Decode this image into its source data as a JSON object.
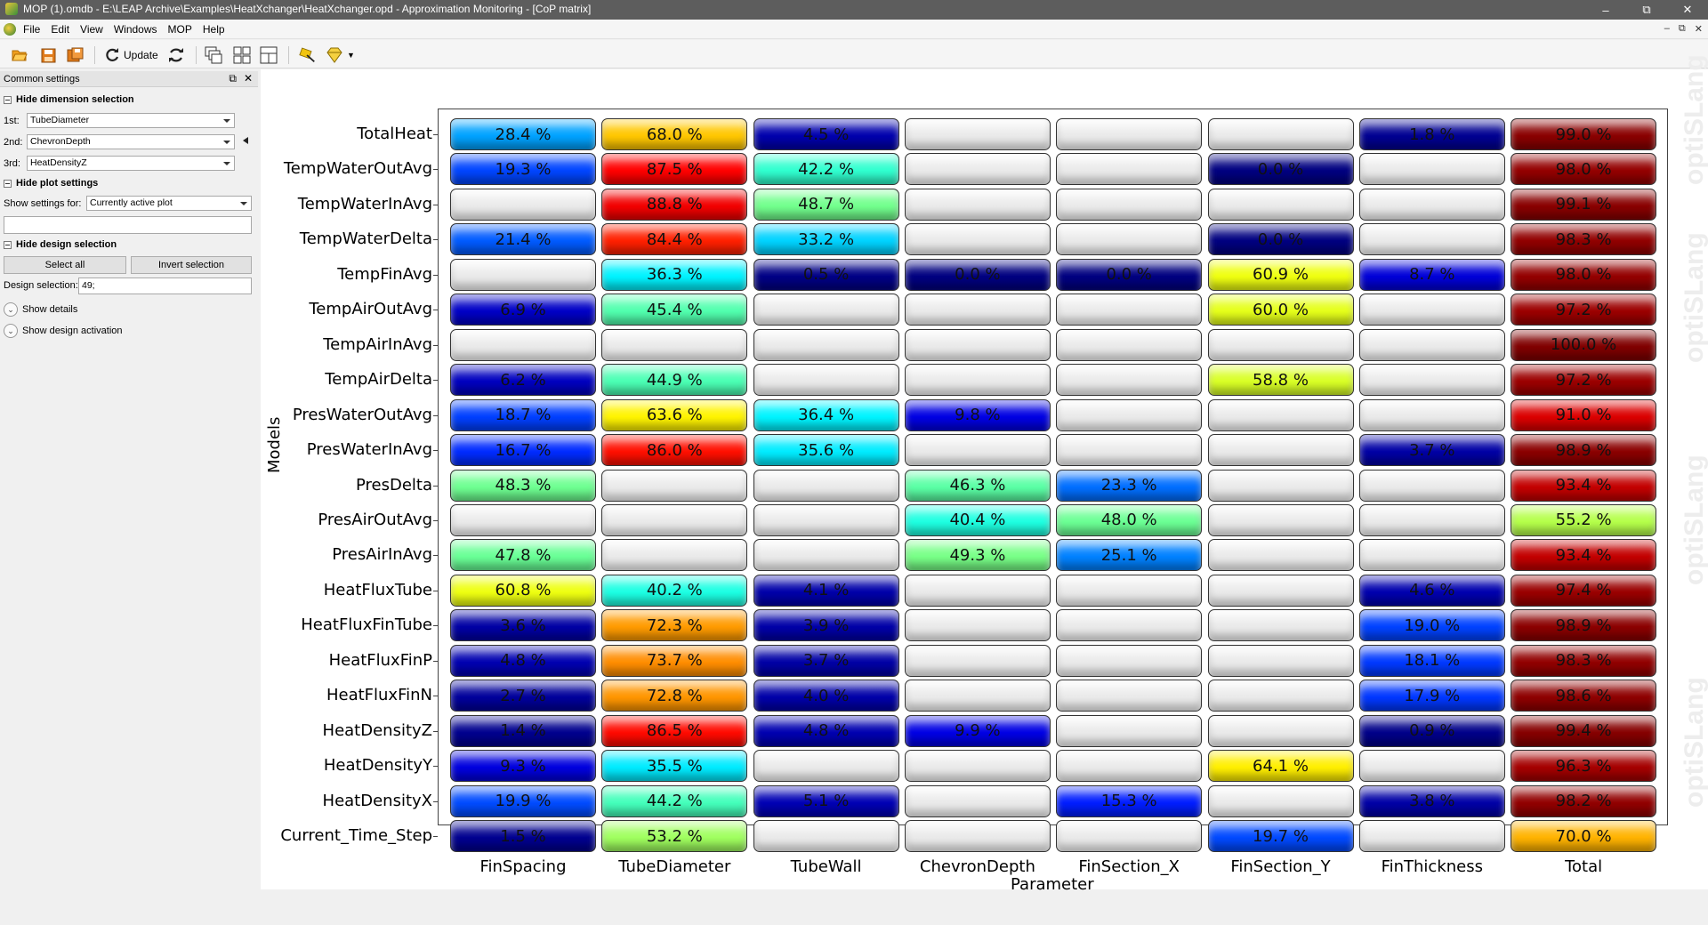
{
  "window": {
    "title": "MOP (1).omdb - E:\\LEAP Archive\\Examples\\HeatXchanger\\HeatXchanger.opd - Approximation Monitoring - [CoP matrix]"
  },
  "menu": [
    "File",
    "Edit",
    "View",
    "Windows",
    "MOP",
    "Help"
  ],
  "toolbar": {
    "update_label": "Update"
  },
  "left_panel": {
    "header": "Common settings",
    "dimension_section": "Hide dimension selection",
    "dim1_label": "1st:",
    "dim1_value": "TubeDiameter",
    "dim2_label": "2nd:",
    "dim2_value": "ChevronDepth",
    "dim3_label": "3rd:",
    "dim3_value": "HeatDensityZ",
    "plot_section": "Hide plot settings",
    "show_settings_label": "Show settings for:",
    "show_settings_value": "Currently active plot",
    "design_section": "Hide design selection",
    "select_all": "Select all",
    "invert_selection": "Invert selection",
    "design_selection_label": "Design selection:",
    "design_selection_value": "49;",
    "show_details": "Show details",
    "show_design_activation": "Show design activation"
  },
  "watermark": "optiSLang",
  "chart_data": {
    "type": "heatmap",
    "xlabel": "Parameter",
    "ylabel": "Models",
    "columns": [
      "FinSpacing",
      "TubeDiameter",
      "TubeWall",
      "ChevronDepth",
      "FinSection_X",
      "FinSection_Y",
      "FinThickness",
      "Total"
    ],
    "rows": [
      {
        "name": "TotalHeat",
        "values": [
          28.4,
          68.0,
          4.5,
          null,
          null,
          null,
          1.8,
          99.0
        ]
      },
      {
        "name": "TempWaterOutAvg",
        "values": [
          19.3,
          87.5,
          42.2,
          null,
          null,
          0.0,
          null,
          98.0
        ]
      },
      {
        "name": "TempWaterInAvg",
        "values": [
          null,
          88.8,
          48.7,
          null,
          null,
          null,
          null,
          99.1
        ]
      },
      {
        "name": "TempWaterDelta",
        "values": [
          21.4,
          84.4,
          33.2,
          null,
          null,
          0.0,
          null,
          98.3
        ]
      },
      {
        "name": "TempFinAvg",
        "values": [
          null,
          36.3,
          0.5,
          0.0,
          0.0,
          60.9,
          8.7,
          98.0
        ]
      },
      {
        "name": "TempAirOutAvg",
        "values": [
          6.9,
          45.4,
          null,
          null,
          null,
          60.0,
          null,
          97.2
        ]
      },
      {
        "name": "TempAirInAvg",
        "values": [
          null,
          null,
          null,
          null,
          null,
          null,
          null,
          100.0
        ]
      },
      {
        "name": "TempAirDelta",
        "values": [
          6.2,
          44.9,
          null,
          null,
          null,
          58.8,
          null,
          97.2
        ]
      },
      {
        "name": "PresWaterOutAvg",
        "values": [
          18.7,
          63.6,
          36.4,
          9.8,
          null,
          null,
          null,
          91.0
        ]
      },
      {
        "name": "PresWaterInAvg",
        "values": [
          16.7,
          86.0,
          35.6,
          null,
          null,
          null,
          3.7,
          98.9
        ]
      },
      {
        "name": "PresDelta",
        "values": [
          48.3,
          null,
          null,
          46.3,
          23.3,
          null,
          null,
          93.4
        ]
      },
      {
        "name": "PresAirOutAvg",
        "values": [
          null,
          null,
          null,
          40.4,
          48.0,
          null,
          null,
          55.2
        ]
      },
      {
        "name": "PresAirInAvg",
        "values": [
          47.8,
          null,
          null,
          49.3,
          25.1,
          null,
          null,
          93.4
        ]
      },
      {
        "name": "HeatFluxTube",
        "values": [
          60.8,
          40.2,
          4.1,
          null,
          null,
          null,
          4.6,
          97.4
        ]
      },
      {
        "name": "HeatFluxFinTube",
        "values": [
          3.6,
          72.3,
          3.9,
          null,
          null,
          null,
          19.0,
          98.9
        ]
      },
      {
        "name": "HeatFluxFinP",
        "values": [
          4.8,
          73.7,
          3.7,
          null,
          null,
          null,
          18.1,
          98.3
        ]
      },
      {
        "name": "HeatFluxFinN",
        "values": [
          2.7,
          72.8,
          4.0,
          null,
          null,
          null,
          17.9,
          98.6
        ]
      },
      {
        "name": "HeatDensityZ",
        "values": [
          1.4,
          86.5,
          4.8,
          9.9,
          null,
          null,
          0.9,
          99.4
        ]
      },
      {
        "name": "HeatDensityY",
        "values": [
          9.3,
          35.5,
          null,
          null,
          null,
          64.1,
          null,
          96.3
        ]
      },
      {
        "name": "HeatDensityX",
        "values": [
          19.9,
          44.2,
          5.1,
          null,
          15.3,
          null,
          3.8,
          98.2
        ]
      },
      {
        "name": "Current_Time_Step",
        "values": [
          1.5,
          53.2,
          null,
          null,
          null,
          19.7,
          null,
          70.0
        ]
      }
    ],
    "value_suffix": " %",
    "range": [
      0,
      100
    ],
    "colormap": "jet (blue→cyan→green→yellow→orange→red)",
    "empty_cell_color": "#e3e3e3"
  }
}
